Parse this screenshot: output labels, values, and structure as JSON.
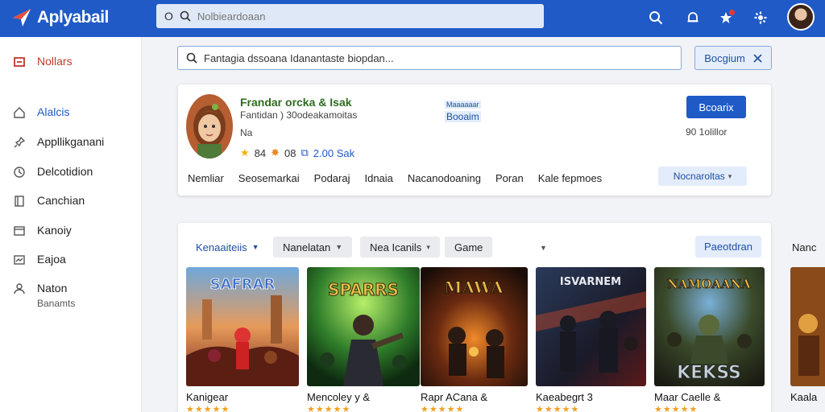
{
  "header": {
    "logo_text": "Aplyabail",
    "search_prefix": "O",
    "search_placeholder": "Nolbieardoaan",
    "icons": [
      "search-icon",
      "bell-icon",
      "star-notification-icon",
      "settings-icon"
    ]
  },
  "sidebar": {
    "items": [
      {
        "label": "Nollars",
        "icon": "inbox-icon",
        "state": "active"
      },
      {
        "label": "Alalcis",
        "icon": "home-icon",
        "state": "highlight"
      },
      {
        "label": "Appllikganani",
        "icon": "pin-icon"
      },
      {
        "label": "Delcotidion",
        "icon": "clock-icon"
      },
      {
        "label": "Canchian",
        "icon": "book-icon"
      },
      {
        "label": "Kanoiy",
        "icon": "window-icon"
      },
      {
        "label": "Eajoa",
        "icon": "chart-icon"
      },
      {
        "label": "Naton",
        "sub": "Banamts",
        "icon": "people-icon"
      }
    ]
  },
  "subsearch": {
    "value": "Fantagia dssoana Idanantaste biopdan...",
    "button_label": "Bocgium"
  },
  "profile": {
    "name": "Frandar orcka & Isak",
    "subtitle": "Fantidan ) 30odeakamoitas",
    "small": "Na",
    "rating": "84",
    "rating2": "08",
    "downloads": "2.00 Sak",
    "badge_line1": "Maaaaaar",
    "badge_line2": "Booaim",
    "primary_button": "Bcoarix",
    "count": "90 1olillor",
    "tabs": [
      "Nemliar",
      "Seosemarkai",
      "Podaraj",
      "Idnaia",
      "Nacanodoaning",
      "Poran",
      "Kale fepmoes"
    ],
    "more_button": "Nocnaroltas"
  },
  "games": {
    "filters": [
      {
        "label": "Kenaaiteiis",
        "style": "primary",
        "chevron": true
      },
      {
        "label": "Nanelatan",
        "style": "grey",
        "chevron": true
      },
      {
        "label": "Nea Icanils",
        "style": "grey",
        "chevron": true
      },
      {
        "label": "Game",
        "style": "grey",
        "chevron": false
      }
    ],
    "action_label": "Paeotdran",
    "overflow_label": "Nanc",
    "cards": [
      {
        "title": "Kanigear",
        "art_title": "SAFRAR",
        "stars": "★★★★★"
      },
      {
        "title": "Mencoley y &",
        "art_title": "SPARRS",
        "stars": "★★★★★"
      },
      {
        "title": "Rapr ACana &",
        "art_title": "MAWA",
        "stars": "★★★★★"
      },
      {
        "title": "Kaeabegrt 3",
        "art_title": "ISVARNEM",
        "stars": "★★★★★"
      },
      {
        "title": "Maar Caelle &",
        "art_title": "NAMOAANA",
        "art_sub": "KEKSS",
        "stars": "★★★★★"
      }
    ],
    "peek_title": "Kaala"
  }
}
